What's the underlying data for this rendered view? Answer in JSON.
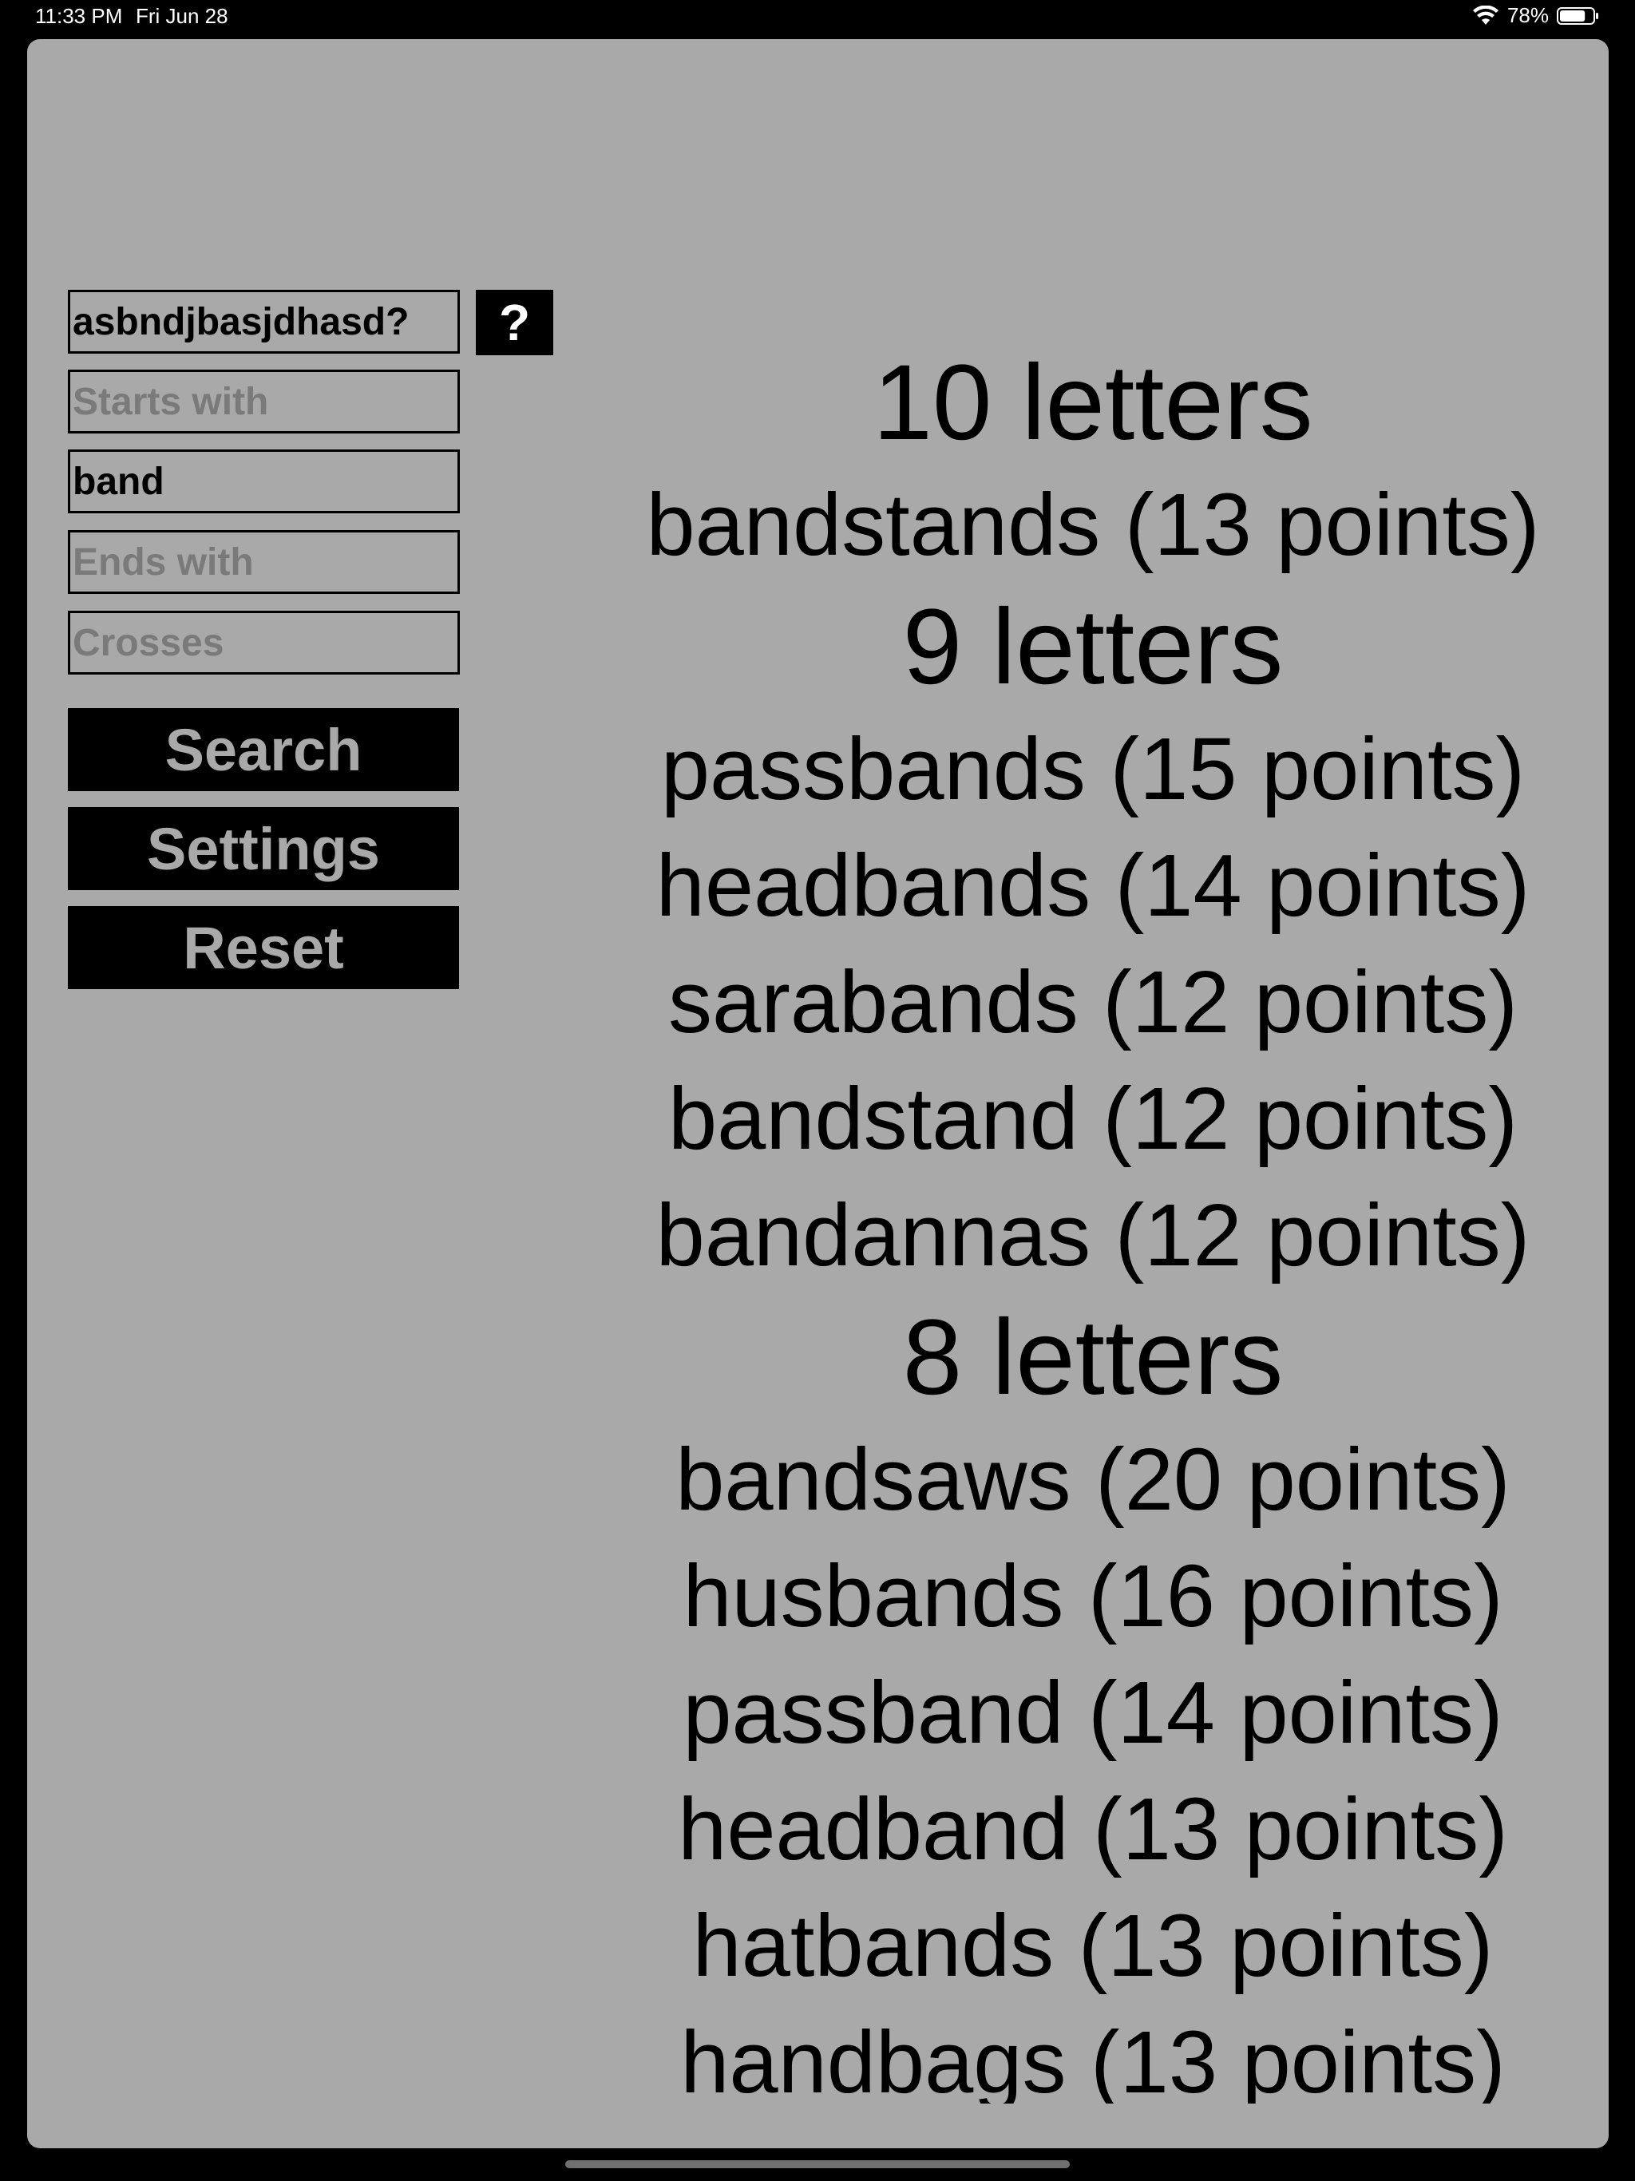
{
  "status_bar": {
    "time": "11:33 PM",
    "date": "Fri Jun 28",
    "battery_percent": "78%",
    "battery_level": 0.78
  },
  "form": {
    "letters": {
      "value": "asbndjbasjdhasd?",
      "placeholder": ""
    },
    "starts_with": {
      "value": "",
      "placeholder": "Starts with"
    },
    "contains": {
      "value": "band",
      "placeholder": ""
    },
    "ends_with": {
      "value": "",
      "placeholder": "Ends with"
    },
    "crosses": {
      "value": "",
      "placeholder": "Crosses"
    },
    "help_label": "?"
  },
  "buttons": {
    "search": "Search",
    "settings": "Settings",
    "reset": "Reset"
  },
  "results": [
    {
      "heading": "10 letters",
      "items": [
        "bandstands (13 points)"
      ]
    },
    {
      "heading": "9 letters",
      "items": [
        "passbands (15 points)",
        "headbands (14 points)",
        "sarabands (12 points)",
        "bandstand (12 points)",
        "bandannas (12 points)"
      ]
    },
    {
      "heading": "8 letters",
      "items": [
        "bandsaws (20 points)",
        "husbands (16 points)",
        "passband (14 points)",
        "headband (13 points)",
        "hatbands (13 points)",
        "handbags (13 points)"
      ]
    }
  ]
}
